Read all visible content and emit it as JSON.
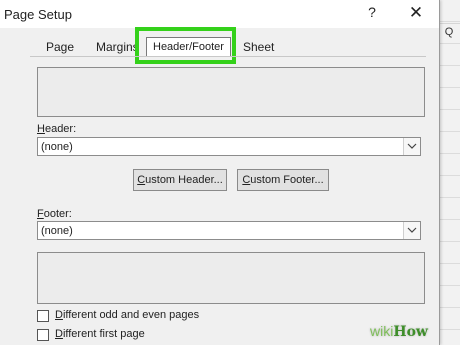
{
  "background": {
    "column_letter": "Q"
  },
  "dialog": {
    "title": "Page Setup",
    "help_symbol": "?",
    "close_symbol": "✕",
    "tabs": [
      {
        "label": "Page",
        "active": false
      },
      {
        "label": "Margins",
        "active": false
      },
      {
        "label": "Header/Footer",
        "active": true,
        "highlight_color": "#34d11a"
      },
      {
        "label": "Sheet",
        "active": false
      }
    ],
    "header": {
      "label_underlined": "H",
      "label_rest": "eader:",
      "value": "(none)"
    },
    "buttons": {
      "custom_header_u": "C",
      "custom_header_rest": "ustom Header...",
      "custom_footer_u": "C",
      "custom_footer_rest": "ustom Footer..."
    },
    "footer": {
      "label_underlined": "F",
      "label_rest": "ooter:",
      "value": "(none)"
    },
    "checkboxes": [
      {
        "label_u": "D",
        "label_rest": "ifferent odd and even pages",
        "checked": false
      },
      {
        "label_u": "D",
        "label_rest": "ifferent first page",
        "checked": false
      }
    ]
  },
  "watermark": {
    "wiki": "wiki",
    "how": "How"
  }
}
